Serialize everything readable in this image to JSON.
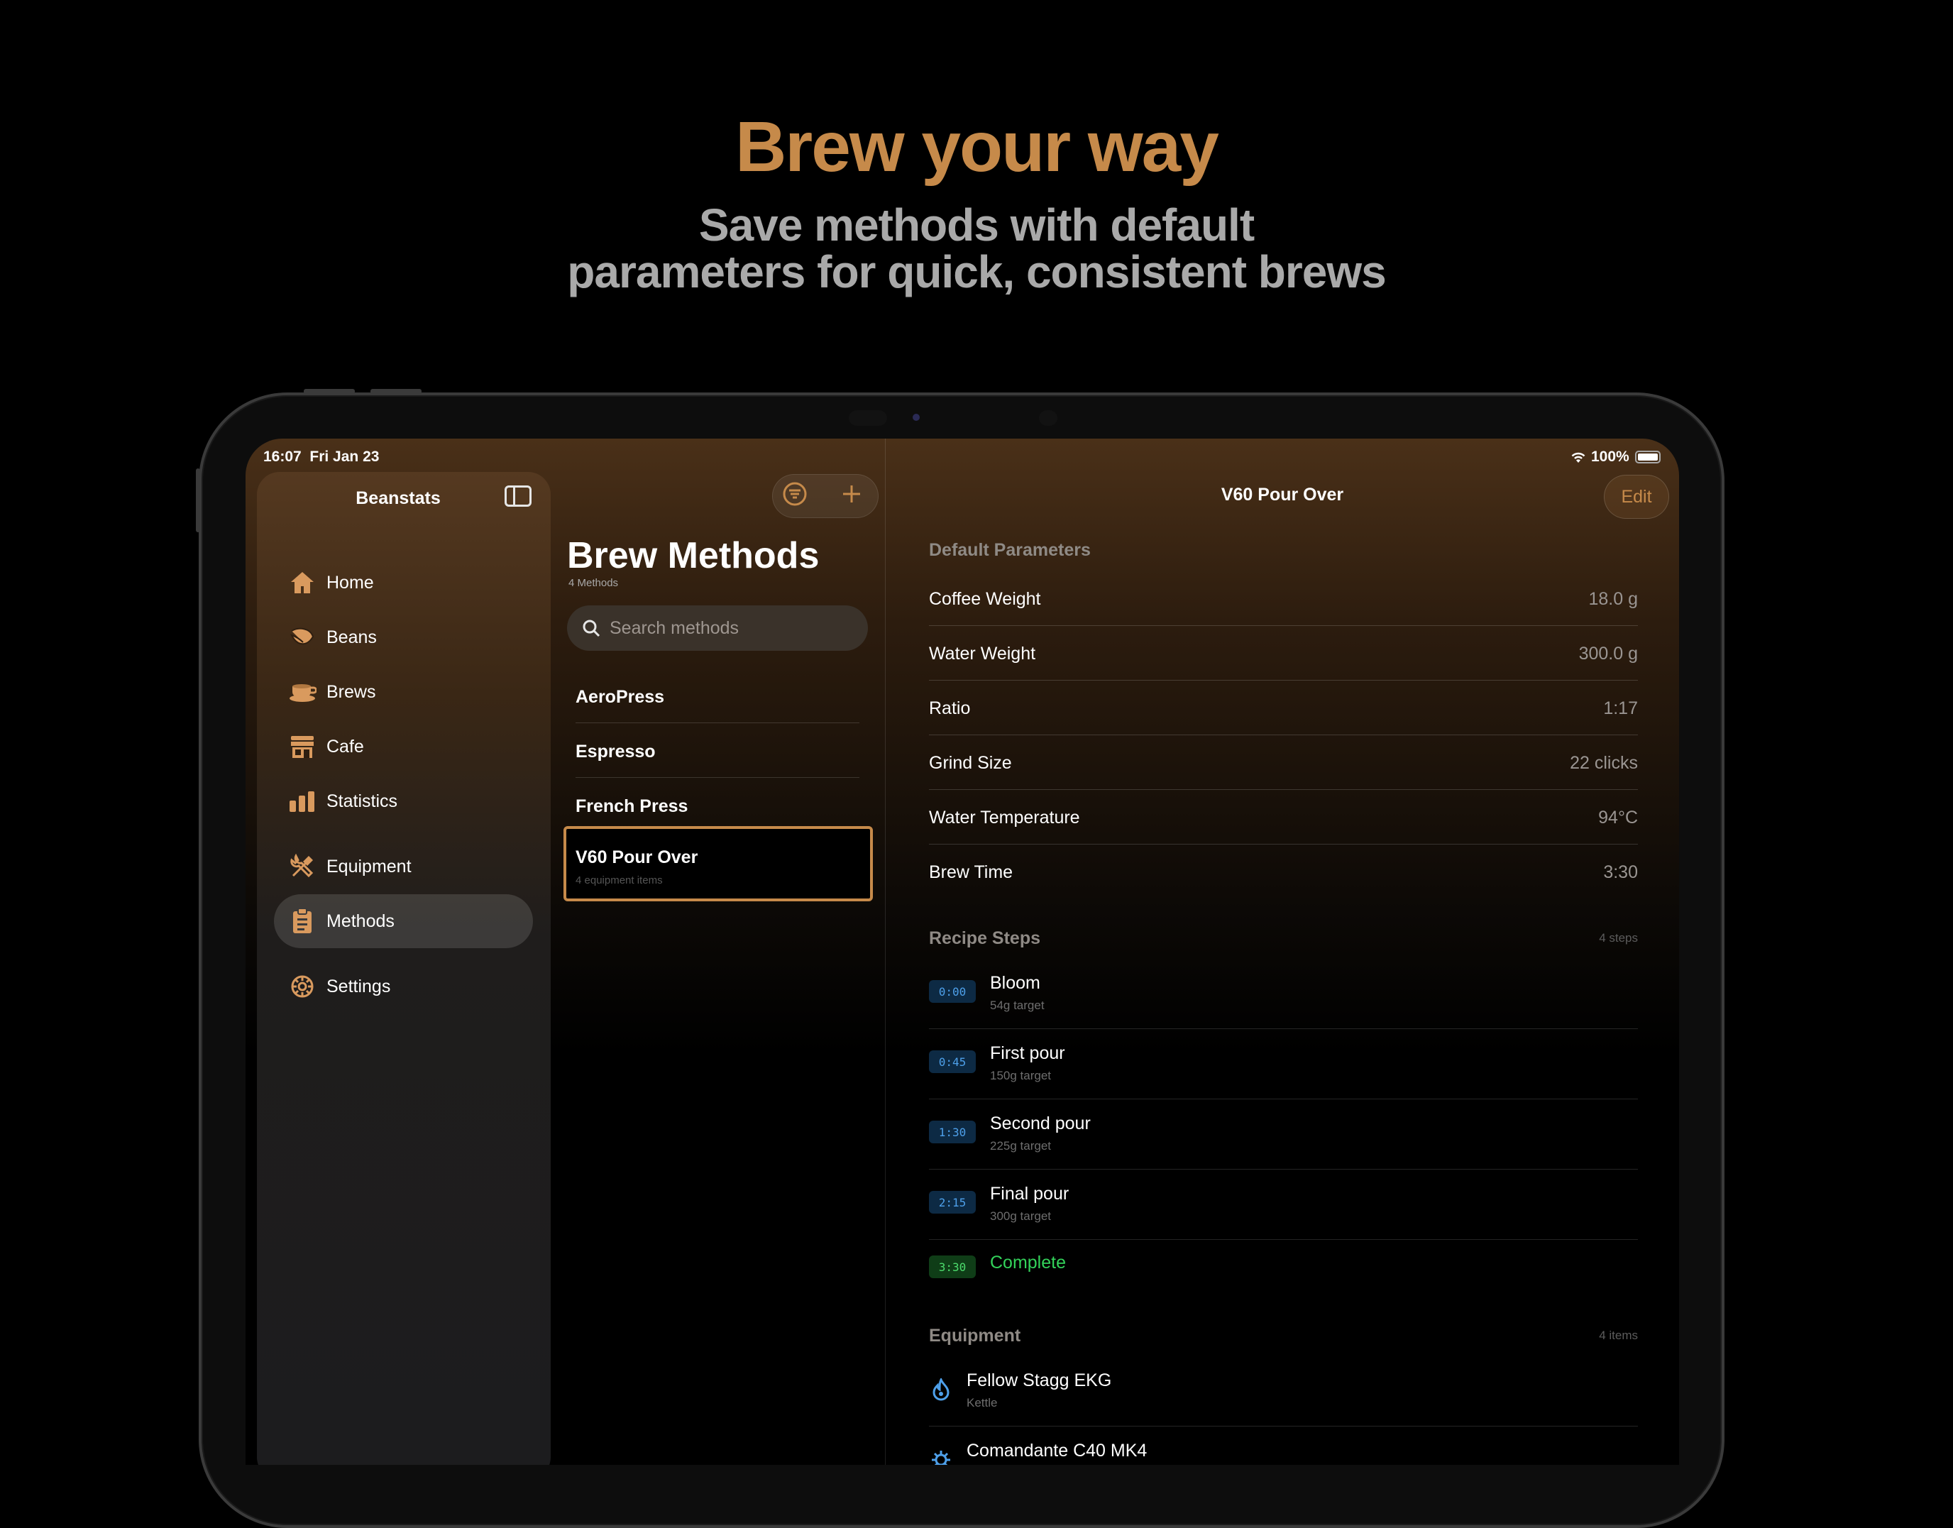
{
  "marketing": {
    "headline": "Brew your way",
    "subline_1": "Save methods with default",
    "subline_2": "parameters for quick, consistent brews"
  },
  "status_bar": {
    "time": "16:07",
    "date": "Fri Jan 23",
    "battery": "100%"
  },
  "sidebar": {
    "title": "Beanstats",
    "items": [
      {
        "label": "Home",
        "icon": "house-icon"
      },
      {
        "label": "Beans",
        "icon": "leaf-icon"
      },
      {
        "label": "Brews",
        "icon": "cup-icon"
      },
      {
        "label": "Cafe",
        "icon": "storefront-icon"
      },
      {
        "label": "Statistics",
        "icon": "bar-chart-icon"
      },
      {
        "label": "Equipment",
        "icon": "tools-icon"
      },
      {
        "label": "Methods",
        "icon": "clipboard-icon",
        "selected": true
      },
      {
        "label": "Settings",
        "icon": "gear-icon"
      }
    ]
  },
  "methods_list": {
    "title": "Brew Methods",
    "count": "4 Methods",
    "search_placeholder": "Search methods",
    "items": [
      {
        "name": "AeroPress"
      },
      {
        "name": "Espresso"
      },
      {
        "name": "French Press"
      },
      {
        "name": "V60 Pour Over",
        "subtitle": "4 equipment items",
        "selected": true
      }
    ]
  },
  "detail": {
    "title": "V60 Pour Over",
    "edit_label": "Edit",
    "default_parameters": {
      "header": "Default Parameters",
      "rows": [
        {
          "label": "Coffee Weight",
          "value": "18.0 g"
        },
        {
          "label": "Water Weight",
          "value": "300.0 g"
        },
        {
          "label": "Ratio",
          "value": "1:17"
        },
        {
          "label": "Grind Size",
          "value": "22 clicks"
        },
        {
          "label": "Water Temperature",
          "value": "94°C"
        },
        {
          "label": "Brew Time",
          "value": "3:30"
        }
      ]
    },
    "recipe_steps": {
      "header": "Recipe Steps",
      "count": "4 steps",
      "steps": [
        {
          "time": "0:00",
          "title": "Bloom",
          "target": "54g target"
        },
        {
          "time": "0:45",
          "title": "First pour",
          "target": "150g target"
        },
        {
          "time": "1:30",
          "title": "Second pour",
          "target": "225g target"
        },
        {
          "time": "2:15",
          "title": "Final pour",
          "target": "300g target"
        }
      ],
      "complete": {
        "time": "3:30",
        "label": "Complete"
      }
    },
    "equipment": {
      "header": "Equipment",
      "count": "4 items",
      "items": [
        {
          "name": "Fellow Stagg EKG",
          "type": "Kettle",
          "icon": "kettle-flame-icon"
        },
        {
          "name": "Comandante C40 MK4",
          "type": "",
          "icon": "grinder-gear-icon"
        }
      ]
    }
  },
  "colors": {
    "accent": "#c68a4a",
    "step_time_blue": "#4ea0ea",
    "complete_green": "#33d25a"
  }
}
